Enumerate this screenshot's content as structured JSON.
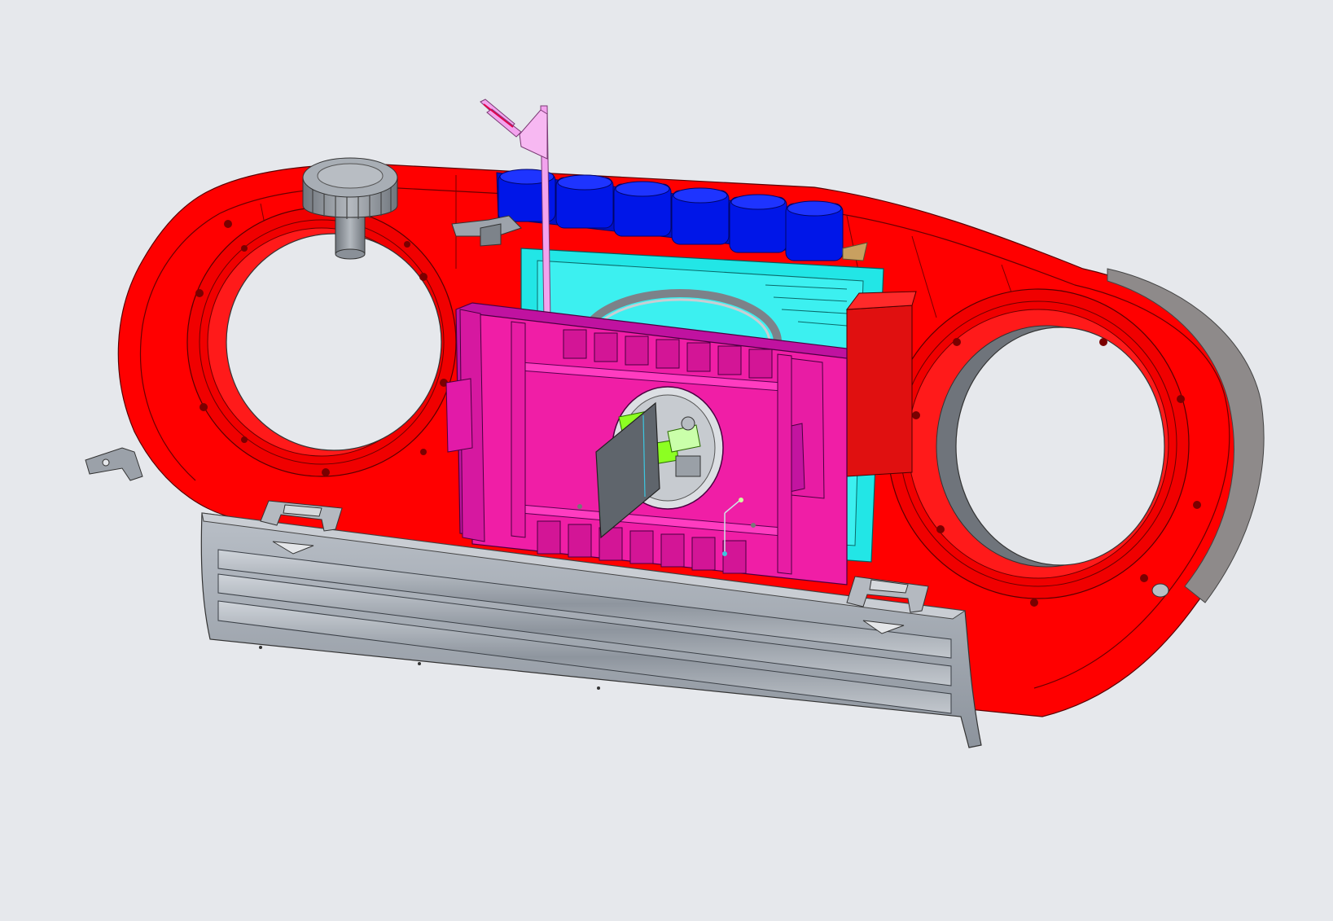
{
  "viewport": {
    "background": "#e6e8ec"
  },
  "model": {
    "parts": [
      {
        "name": "main-housing",
        "color": "#ff0000"
      },
      {
        "name": "battery-tray",
        "color": "#f01ea6"
      },
      {
        "name": "button-row",
        "color": "#0016e8",
        "count": 6
      },
      {
        "name": "inner-chassis",
        "color": "#22e6e6"
      },
      {
        "name": "front-grille-cover",
        "color": "#a7adb6"
      },
      {
        "name": "volume-knob",
        "color": "#8a9098"
      },
      {
        "name": "pink-lever",
        "color": "#f3a3ee"
      },
      {
        "name": "green-contacts",
        "color": "#8cff22"
      },
      {
        "name": "speaker-left-opening",
        "color": "#e6e8ec"
      },
      {
        "name": "speaker-right-opening",
        "color": "#e6e8ec"
      }
    ]
  }
}
